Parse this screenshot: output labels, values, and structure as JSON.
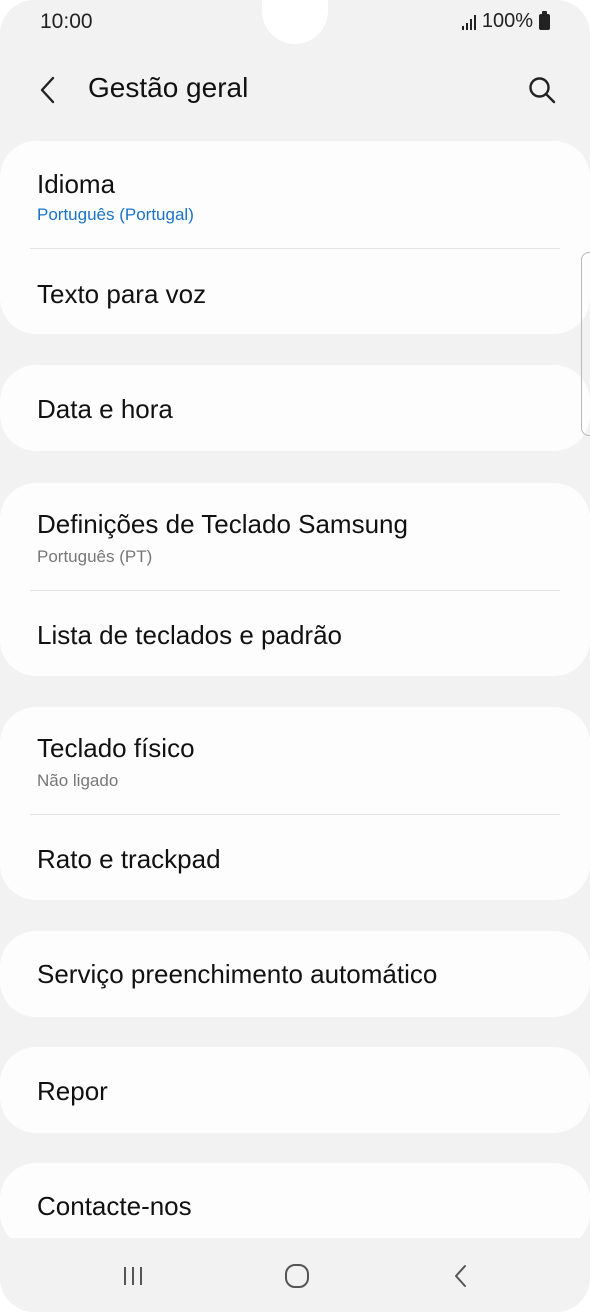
{
  "status_bar": {
    "time": "10:00",
    "battery": "100%"
  },
  "header": {
    "title": "Gestão geral",
    "back_icon": "chevron-left-icon",
    "search_icon": "search-icon"
  },
  "items": {
    "idioma": {
      "title": "Idioma",
      "subtitle": "Português (Portugal)"
    },
    "texto_voz": {
      "title": "Texto para voz"
    },
    "data_hora": {
      "title": "Data e hora"
    },
    "teclado_samsung": {
      "title": "Definições de Teclado Samsung",
      "subtitle": "Português (PT)"
    },
    "lista_teclados": {
      "title": "Lista de teclados e padrão"
    },
    "teclado_fisico": {
      "title": "Teclado físico",
      "subtitle": "Não ligado"
    },
    "rato": {
      "title": "Rato e trackpad"
    },
    "servico": {
      "title": "Serviço preenchimento automático"
    },
    "repor": {
      "title": "Repor"
    },
    "contacte": {
      "title": "Contacte-nos"
    }
  },
  "nav_bar": {
    "recents_icon": "recents-icon",
    "home_icon": "home-icon",
    "back_icon": "back-icon"
  },
  "colors": {
    "background": "#f2f2f2",
    "card": "#fdfdfd",
    "accent": "#1a73c9",
    "subtitle": "#777777"
  }
}
